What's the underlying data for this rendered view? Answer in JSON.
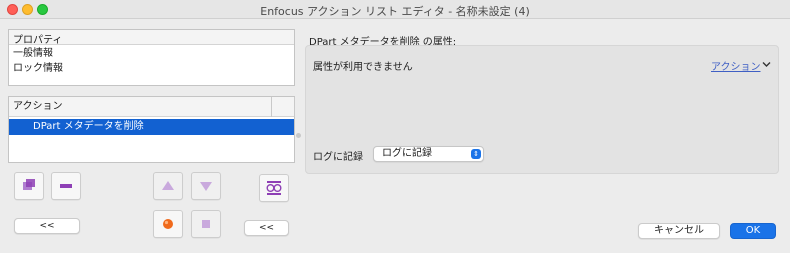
{
  "window": {
    "title": "Enfocus アクション リスト エディタ - 名称未設定 (4)"
  },
  "properties_panel": {
    "header": "プロパティ",
    "items": [
      "一般情報",
      "ロック情報"
    ]
  },
  "actions_panel": {
    "header": "アクション",
    "items": [
      "DPart メタデータを削除"
    ],
    "selected_index": 0
  },
  "buttons": {
    "collapse_left_label": "<<",
    "collapse_right_label": "<<",
    "cancel_label": "キャンセル",
    "ok_label": "OK"
  },
  "attributes": {
    "title": "DPart メタデータを削除 の属性:",
    "message": "属性が利用できません",
    "action_menu_label": "アクション",
    "log_label": "ログに記録",
    "log_select_value": "ログに記録"
  },
  "icons": {
    "add": "add-action-icon",
    "remove": "remove-action-icon",
    "move_up": "move-up-icon",
    "move_down": "move-down-icon",
    "preview": "preview-glasses-icon",
    "record": "record-icon",
    "stop": "stop-icon",
    "chevron": "chevron-down-icon"
  },
  "colors": {
    "selection": "#1261d1",
    "ok_button": "#1a73e8",
    "icon_purple": "#8e3fb5",
    "record_orange": "#f06a1c"
  }
}
